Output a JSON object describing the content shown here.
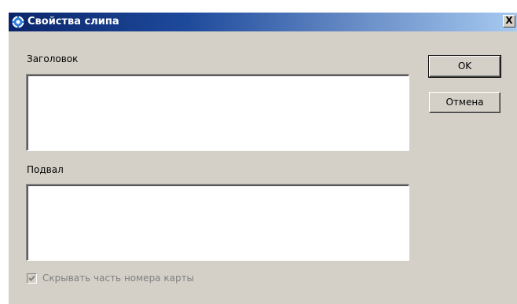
{
  "window": {
    "title": "Свойства слипа",
    "close_label": "X",
    "icon": "gear-icon"
  },
  "form": {
    "header_label": "Заголовок",
    "header_value": "",
    "footer_label": "Подвал",
    "footer_value": "",
    "hide_card_label": "Скрывать часть номера карты",
    "hide_card_checked": true,
    "hide_card_enabled": false
  },
  "buttons": {
    "ok_label": "OK",
    "cancel_label": "Отмена"
  },
  "colors": {
    "titlebar_start": "#0a246a",
    "titlebar_end": "#a6caf0",
    "face": "#d4d0c8",
    "disabled_text": "#808080"
  }
}
